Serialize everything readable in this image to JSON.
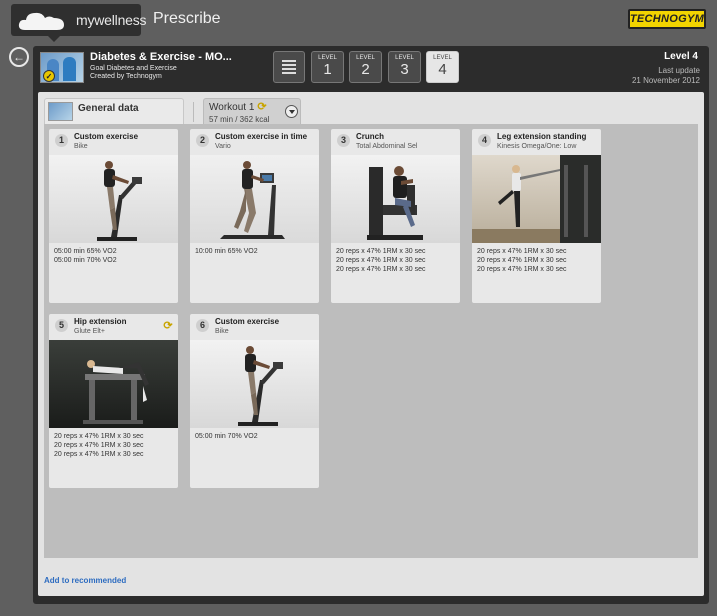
{
  "header": {
    "logo_text": "mywellness",
    "app_title": "Prescribe",
    "brand": "TECHNOGYM"
  },
  "plan": {
    "title": "Diabetes & Exercise - MO...",
    "goal": "Goal Diabetes and Exercise",
    "creator": "Created by Technogym",
    "level_label": "LEVEL",
    "levels": [
      "1",
      "2",
      "3",
      "4"
    ],
    "current_level": "Level 4",
    "last_update_label": "Last update",
    "last_update_date": "21 November 2012"
  },
  "tabs": {
    "general": "General data",
    "workout": "Workout 1",
    "workout_sub": "57 min / 362 kcal"
  },
  "exercises": [
    {
      "n": "1",
      "name": "Custom exercise",
      "equip": "Bike",
      "details": [
        "05:00 min 65% VO2",
        "05:00 min 70% VO2"
      ]
    },
    {
      "n": "2",
      "name": "Custom exercise in time",
      "equip": "Vario",
      "details": [
        "10:00 min 65% VO2"
      ]
    },
    {
      "n": "3",
      "name": "Crunch",
      "equip": "Total Abdominal Sel",
      "details": [
        "20 reps x 47% 1RM x 30 sec",
        "20 reps x 47% 1RM x 30 sec",
        "20 reps x 47% 1RM x 30 sec"
      ]
    },
    {
      "n": "4",
      "name": "Leg extension standing",
      "equip": "Kinesis Omega/One: Low",
      "details": [
        "20 reps x 47% 1RM x 30 sec",
        "20 reps x 47% 1RM x 30 sec",
        "20 reps x 47% 1RM x 30 sec"
      ]
    },
    {
      "n": "5",
      "name": "Hip extension",
      "equip": "Glute Elt+",
      "details": [
        "20 reps x 47% 1RM x 30 sec",
        "20 reps x 47% 1RM x 30 sec",
        "20 reps x 47% 1RM x 30 sec"
      ]
    },
    {
      "n": "6",
      "name": "Custom exercise",
      "equip": "Bike",
      "details": [
        "05:00 min 70% VO2"
      ]
    }
  ],
  "footer": {
    "add_link": "Add to recommended"
  },
  "colors": {
    "brand_yellow": "#f2d400",
    "link_blue": "#2d6cc0",
    "panel_dark": "#2c2c2c"
  }
}
